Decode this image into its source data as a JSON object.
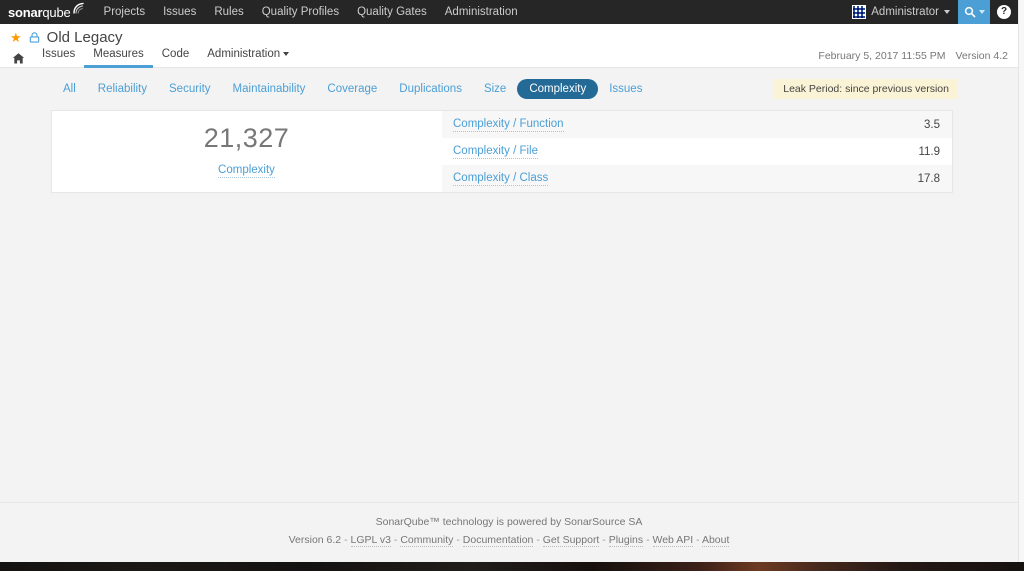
{
  "global_nav": {
    "logo": {
      "bold": "sonar",
      "light": "qube",
      "icon": "signal-wave-icon"
    },
    "items": [
      {
        "label": "Projects",
        "name": "projects"
      },
      {
        "label": "Issues",
        "name": "issues"
      },
      {
        "label": "Rules",
        "name": "rules"
      },
      {
        "label": "Quality Profiles",
        "name": "quality-profiles"
      },
      {
        "label": "Quality Gates",
        "name": "quality-gates"
      },
      {
        "label": "Administration",
        "name": "administration"
      }
    ],
    "account": {
      "label": "Administrator",
      "avatar": "identicon-avatar"
    },
    "search": {
      "icon": "search-icon",
      "accent": "#4b9fd5"
    },
    "help": {
      "icon": "help-circle-icon",
      "glyph": "?"
    }
  },
  "context_nav": {
    "favorite_icon": "star-icon",
    "favorite_color": "#ff9900",
    "visibility_icon": "lock-icon",
    "project_name": "Old Legacy",
    "analysis_date": "February 5, 2017 11:55 PM",
    "version": "Version 4.2",
    "home_icon": "home-icon",
    "tabs": [
      {
        "label": "Issues",
        "name": "issues",
        "active": false,
        "dropdown": false
      },
      {
        "label": "Measures",
        "name": "measures",
        "active": true,
        "dropdown": false
      },
      {
        "label": "Code",
        "name": "code",
        "active": false,
        "dropdown": false
      },
      {
        "label": "Administration",
        "name": "administration",
        "active": false,
        "dropdown": true
      }
    ]
  },
  "measures": {
    "domains": [
      {
        "label": "All",
        "name": "all",
        "active": false
      },
      {
        "label": "Reliability",
        "name": "reliability",
        "active": false
      },
      {
        "label": "Security",
        "name": "security",
        "active": false
      },
      {
        "label": "Maintainability",
        "name": "maintainability",
        "active": false
      },
      {
        "label": "Coverage",
        "name": "coverage",
        "active": false
      },
      {
        "label": "Duplications",
        "name": "duplications",
        "active": false
      },
      {
        "label": "Size",
        "name": "size",
        "active": false
      },
      {
        "label": "Complexity",
        "name": "complexity",
        "active": true
      },
      {
        "label": "Issues",
        "name": "issues",
        "active": false
      }
    ],
    "leak_period": "Leak Period: since previous version",
    "overview": {
      "value": "21,327",
      "label": "Complexity"
    },
    "rows": [
      {
        "name": "Complexity / Function",
        "value": "3.5"
      },
      {
        "name": "Complexity / File",
        "value": "11.9"
      },
      {
        "name": "Complexity / Class",
        "value": "17.8"
      }
    ]
  },
  "footer": {
    "line1": "SonarQube™ technology is powered by SonarSource SA",
    "version": "Version 6.2",
    "links": [
      "LGPL v3",
      "Community",
      "Documentation",
      "Get Support",
      "Plugins",
      "Web API",
      "About"
    ],
    "separator": "-"
  },
  "colors": {
    "nav_background": "#262626",
    "accent_blue": "#4b9fd5",
    "active_pill": "#236a97",
    "leak_yellow": "#fbf3d5",
    "star_orange": "#ff9900",
    "page_background": "#f3f3f3"
  }
}
